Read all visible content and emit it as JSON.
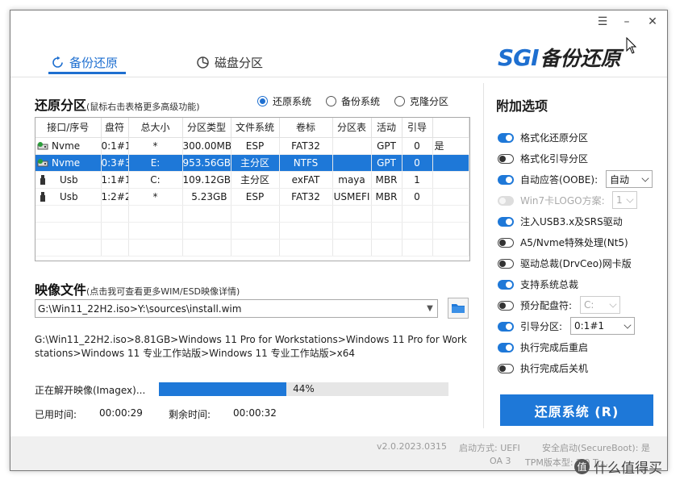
{
  "window": {
    "controls": {
      "menu": "☰",
      "minimize": "–",
      "close": "✕"
    }
  },
  "tabs": [
    {
      "label": "备份还原",
      "active": true,
      "icon": "backup-restore-icon"
    },
    {
      "label": "磁盘分区",
      "active": false,
      "icon": "disk-partition-icon"
    }
  ],
  "logo": {
    "sgi": "SGI",
    "cn": "备份还原"
  },
  "restore_partition": {
    "title": "还原分区",
    "subtitle": "(鼠标右击表格更多高级功能)",
    "modes": [
      {
        "label": "还原系统",
        "checked": true
      },
      {
        "label": "备份系统",
        "checked": false
      },
      {
        "label": "克隆分区",
        "checked": false
      }
    ],
    "columns": [
      "接口/序号",
      "盘符",
      "总大小",
      "分区类型",
      "文件系统",
      "卷标",
      "分区表",
      "活动",
      "引导"
    ],
    "rows": [
      {
        "icon": "nvme-drive-icon",
        "iface": "Nvme",
        "index": "0:1#1",
        "letter": "*",
        "size": "300.00MB",
        "ptype": "ESP",
        "fs": "FAT32",
        "label": "",
        "table": "GPT",
        "active": "0",
        "boot": "是",
        "selected": false
      },
      {
        "icon": "nvme-drive-icon",
        "iface": "Nvme",
        "index": "0:3#3",
        "letter": "E:",
        "size": "953.56GB",
        "ptype": "主分区",
        "fs": "NTFS",
        "label": "",
        "table": "GPT",
        "active": "0",
        "boot": "",
        "selected": true
      },
      {
        "icon": "usb-icon",
        "iface": "Usb",
        "index": "1:1#1",
        "letter": "C:",
        "size": "109.12GB",
        "ptype": "主分区",
        "fs": "exFAT",
        "label": "maya",
        "table": "MBR",
        "active": "1",
        "boot": "",
        "selected": false
      },
      {
        "icon": "usb-icon",
        "iface": "Usb",
        "index": "1:2#2",
        "letter": "*",
        "size": "5.23GB",
        "ptype": "ESP",
        "fs": "FAT32",
        "label": "USMEFI",
        "table": "MBR",
        "active": "0",
        "boot": "",
        "selected": false
      }
    ]
  },
  "image_file": {
    "title": "映像文件",
    "subtitle": "(点击我可查看更多WIM/ESD映像详情)",
    "path": "G:\\Win11_22H2.iso>Y:\\sources\\install.wim",
    "detail": "G:\\Win11_22H2.iso>8.81GB>Windows 11 Pro for Workstations>Windows 11 Pro for Workstations>Windows 11 专业工作站版>Windows 11 专业工作站版>x64"
  },
  "progress": {
    "label": "正在解开映像(Imagex)...",
    "percent_text": "44%",
    "fraction": 0.44,
    "elapsed_label": "已用时间:",
    "elapsed": "00:00:29",
    "remaining_label": "剩余时间:",
    "remaining": "00:00:32"
  },
  "options": {
    "title": "附加选项",
    "items": [
      {
        "label": "格式化还原分区",
        "state": "on"
      },
      {
        "label": "格式化引导分区",
        "state": "off"
      },
      {
        "label": "自动应答(OOBE):",
        "state": "on",
        "select": "自动"
      },
      {
        "label": "Win7卡LOGO方案:",
        "state": "dis",
        "select": "1"
      },
      {
        "label": "注入USB3.x及SRS驱动",
        "state": "on"
      },
      {
        "label": "A5/Nvme特殊处理(Nt5)",
        "state": "off"
      },
      {
        "label": "驱动总裁(DrvCeo)网卡版",
        "state": "off"
      },
      {
        "label": "支持系统总裁",
        "state": "on"
      },
      {
        "label": "预分配盘符:",
        "state": "off",
        "select": "C:"
      },
      {
        "label": "引导分区:",
        "state": "on",
        "select": "0:1#1"
      },
      {
        "label": "执行完成后重启",
        "state": "on"
      },
      {
        "label": "执行完成后关机",
        "state": "off"
      }
    ],
    "restore_button": "还原系统 (R)"
  },
  "footer": {
    "version": "v2.0.2023.0315",
    "boot_mode": "启动方式:  UEFI",
    "secure_boot": "安全启动(SecureBoot):  是",
    "oa": "OA 3",
    "tpm": "TPM版本型:  2.0  Tr..."
  },
  "watermark": {
    "badge": "值",
    "text": "什么值得买"
  },
  "colors": {
    "accent": "#1e78d8",
    "brand": "#1e6fd0"
  }
}
